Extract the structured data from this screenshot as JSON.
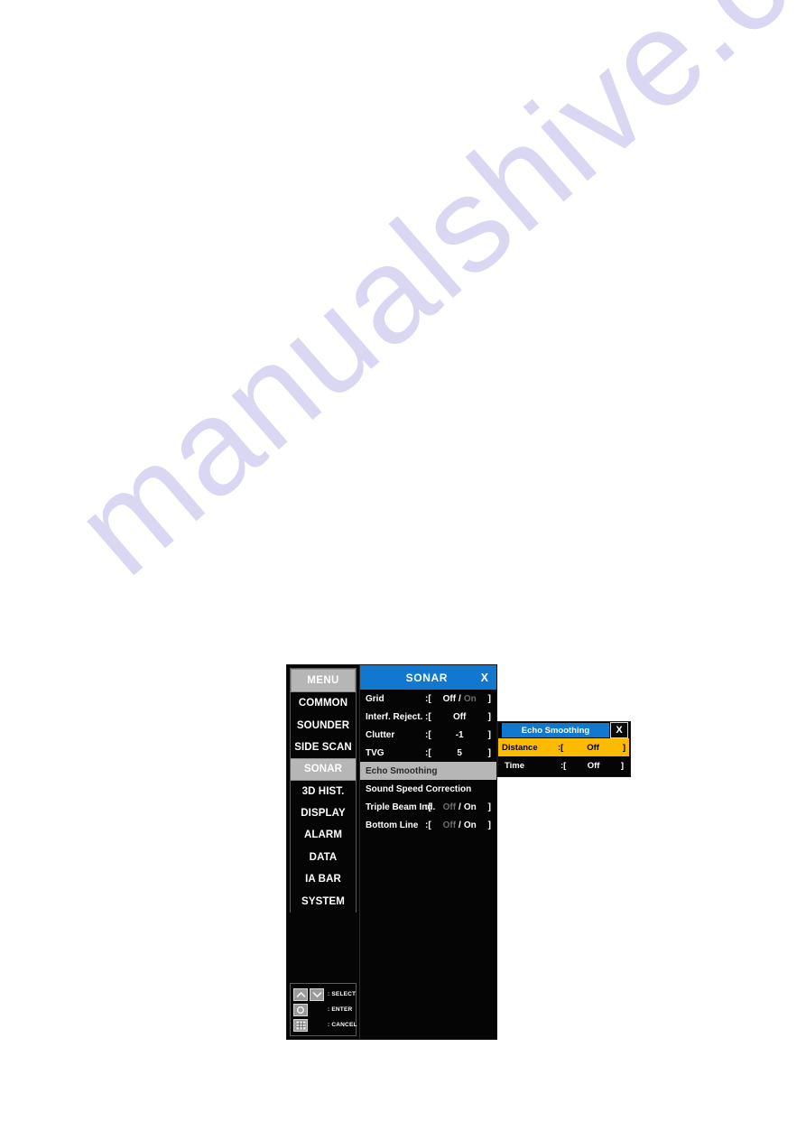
{
  "watermark": {
    "text": "manualshive.com",
    "color": "#d9d7f2"
  },
  "sidebar": {
    "header_label": "MENU",
    "items": [
      {
        "label": "COMMON",
        "selected": false
      },
      {
        "label": "SOUNDER",
        "selected": false
      },
      {
        "label": "SIDE SCAN",
        "selected": false
      },
      {
        "label": "SONAR",
        "selected": true
      },
      {
        "label": "3D HIST.",
        "selected": false
      },
      {
        "label": "DISPLAY",
        "selected": false
      },
      {
        "label": "ALARM",
        "selected": false
      },
      {
        "label": "DATA",
        "selected": false
      },
      {
        "label": "IA BAR",
        "selected": false
      },
      {
        "label": "SYSTEM",
        "selected": false
      }
    ],
    "key_legend": [
      {
        "icons": [
          "chevron-up-icon",
          "chevron-down-icon"
        ],
        "label": ": SELECT"
      },
      {
        "icons": [
          "circle-icon"
        ],
        "label": ": ENTER"
      },
      {
        "icons": [
          "grid-menu-icon"
        ],
        "label": ": CANCEL"
      }
    ]
  },
  "sonar_panel": {
    "title": "SONAR",
    "close_label": "X",
    "accent_color": "#1277ce",
    "highlight_color": "#b6b6b6",
    "rows": [
      {
        "label": "Grid",
        "type": "toggle",
        "open": ":[",
        "close": "]",
        "options": [
          "Off",
          "On"
        ],
        "selected": "Off",
        "highlighted": false
      },
      {
        "label": "Interf. Reject.",
        "type": "value",
        "open": ":[",
        "close": "]",
        "value": "Off",
        "highlighted": false
      },
      {
        "label": "Clutter",
        "type": "value",
        "open": ":[",
        "close": "]",
        "value": "-1",
        "highlighted": false
      },
      {
        "label": "TVG",
        "type": "value",
        "open": ":[",
        "close": "]",
        "value": "5",
        "highlighted": false
      },
      {
        "label": "Echo Smoothing",
        "type": "submenu",
        "highlighted": true
      },
      {
        "label": "Sound Speed Correction",
        "type": "submenu",
        "highlighted": false
      },
      {
        "label": "Triple Beam Ind.",
        "type": "toggle",
        "open": ":[",
        "close": "]",
        "options": [
          "Off",
          "On"
        ],
        "selected": "On",
        "highlighted": false
      },
      {
        "label": "Bottom Line",
        "type": "toggle",
        "open": ":[",
        "close": "]",
        "options": [
          "Off",
          "On"
        ],
        "selected": "On",
        "highlighted": false
      }
    ]
  },
  "popup": {
    "title": "Echo Smoothing",
    "close_label": "X",
    "accent_color": "#1277ce",
    "selected_color": "#fcbb00",
    "rows": [
      {
        "label": "Distance",
        "open": ":[",
        "close": "]",
        "value": "Off",
        "selected": true
      },
      {
        "label": "Time",
        "open": ":[",
        "close": "]",
        "value": "Off",
        "selected": false
      }
    ]
  }
}
